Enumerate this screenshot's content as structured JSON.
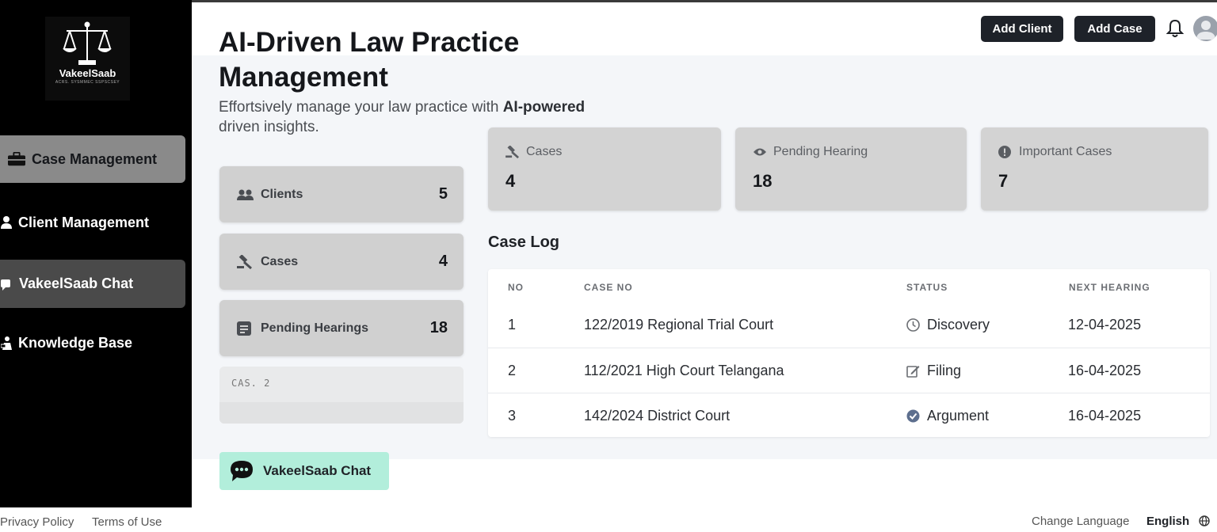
{
  "brand": {
    "name": "VakeelSaab",
    "tagline": "ACRS. SYSMMEC SSPSCSEY",
    "logo_icon": "scales-of-justice-icon"
  },
  "sidebar": {
    "items": [
      {
        "label": "Case Management",
        "icon": "briefcase-icon",
        "active": true
      },
      {
        "label": "Client Management",
        "icon": "user-icon"
      },
      {
        "label": "VakeelSaab Chat",
        "icon": "chat-icon",
        "active": true
      },
      {
        "label": "Knowledge Base",
        "icon": "reader-icon"
      }
    ]
  },
  "header": {
    "title": "AI-Driven Law Practice Management",
    "subtitle_plain": "Effortsively manage your law practice with",
    "subtitle_bold": "AI-powered",
    "subtitle_end": "driven insights.",
    "add_client_label": "Add Client",
    "add_case_label": "Add Case"
  },
  "left_stats": [
    {
      "label": "Clients",
      "value": "5",
      "icon": "users-icon"
    },
    {
      "label": "Cases",
      "value": "4",
      "icon": "gavel-icon"
    },
    {
      "label": "Pending Hearings",
      "value": "18",
      "icon": "list-icon"
    }
  ],
  "ghost_card": {
    "label": "CAS. 2"
  },
  "chat_button": {
    "label": "VakeelSaab Chat",
    "icon": "chat-bubble-icon"
  },
  "top_stats": [
    {
      "label": "Cases",
      "value": "4",
      "icon": "gavel-icon"
    },
    {
      "label": "Pending Hearing",
      "value": "18",
      "icon": "eye-icon"
    },
    {
      "label": "Important Cases",
      "value": "7",
      "icon": "exclamation-circle-icon"
    }
  ],
  "case_log": {
    "title": "Case Log",
    "columns": [
      "NO",
      "CASE NO",
      "STATUS",
      "NEXT HEARING"
    ],
    "rows": [
      {
        "no": "1",
        "case_no": "122/2019 Regional Trial Court",
        "status": "Discovery",
        "status_icon": "clock-icon",
        "next_hearing": "12-04-2025"
      },
      {
        "no": "2",
        "case_no": "112/2021 High Court Telangana",
        "status": "Filing",
        "status_icon": "edit-icon",
        "next_hearing": "16-04-2025"
      },
      {
        "no": "3",
        "case_no": "142/2024 District Court",
        "status": "Argument",
        "status_icon": "check-circle-icon",
        "next_hearing": "16-04-2025"
      }
    ]
  },
  "footer": {
    "privacy": "Privacy Policy",
    "terms": "Terms of Use",
    "change_language": "Change Language",
    "language": "English"
  },
  "colors": {
    "sidebar_bg": "#000000",
    "button_dark": "#1e2229",
    "chat_button_bg": "#b2eedb",
    "card_bg": "#d0d0d0"
  }
}
